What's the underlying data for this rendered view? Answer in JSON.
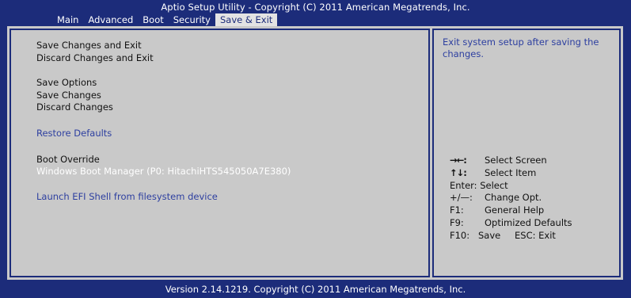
{
  "header": {
    "title": "Aptio Setup Utility - Copyright (C) 2011 American Megatrends, Inc."
  },
  "tabs": [
    {
      "label": "Main"
    },
    {
      "label": "Advanced"
    },
    {
      "label": "Boot"
    },
    {
      "label": "Security"
    },
    {
      "label": "Save & Exit",
      "active": true
    }
  ],
  "menu": {
    "save_changes_and_exit": "Save Changes and Exit",
    "discard_changes_and_exit": "Discard Changes and Exit",
    "save_options": "Save Options",
    "save_changes": "Save Changes",
    "discard_changes": "Discard Changes",
    "restore_defaults": "Restore Defaults",
    "boot_override": "Boot Override",
    "windows_boot_manager": "Windows Boot Manager (P0: HitachiHTS545050A7E380)",
    "launch_efi_shell": "Launch EFI Shell from filesystem device"
  },
  "help": {
    "text": "Exit system setup after saving the changes."
  },
  "keys": {
    "select_screen_key": "→←:",
    "select_screen": "Select Screen",
    "select_item_key": "↑↓:",
    "select_item": "Select Item",
    "enter": "Enter: Select",
    "change_key": "+/—:",
    "change": "Change Opt.",
    "f1_key": "F1:",
    "f1": "General Help",
    "f9_key": "F9:",
    "f9": "Optimized Defaults",
    "f10_key": "F10:",
    "f10": "Save",
    "esc": "ESC:  Exit"
  },
  "footer": {
    "text": "Version 2.14.1219. Copyright (C) 2011 American Megatrends, Inc."
  },
  "colors": {
    "background": "#1c2c7a",
    "panel": "#c9c9c9",
    "link": "#2d3fa0",
    "selected_text": "#ffffff"
  }
}
